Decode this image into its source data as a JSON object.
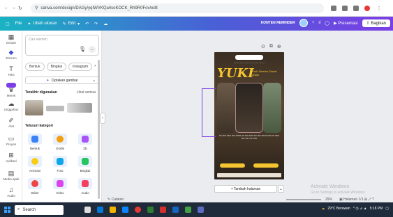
{
  "browser": {
    "url": "canva.com/design/DAGy/yqIWVKQa4soKOCK_Rh9R0Fov/edit"
  },
  "topbar": {
    "file_label": "File",
    "resize_label": "Ubah ukuran",
    "edit_label": "Edit",
    "contest_label": "KONTEN REMINDER",
    "present_label": "Presentasi",
    "share_label": "Bagikan"
  },
  "rail": {
    "items": [
      {
        "label": "Desain",
        "icon": "layout-icon"
      },
      {
        "label": "Elemen",
        "icon": "elements-icon"
      },
      {
        "label": "Teks",
        "icon": "text-icon"
      },
      {
        "label": "Merek",
        "icon": "brand-icon"
      },
      {
        "label": "Unggahan",
        "icon": "upload-icon"
      },
      {
        "label": "Alat",
        "icon": "draw-icon"
      },
      {
        "label": "Proyek",
        "icon": "projects-icon"
      },
      {
        "label": "Aplikasi",
        "icon": "apps-icon"
      },
      {
        "label": "Media ajaib",
        "icon": "magic-media-icon"
      },
      {
        "label": "Audio",
        "icon": "audio-icon"
      }
    ]
  },
  "panel": {
    "search_placeholder": "Cari elemen",
    "chips": [
      "Bentuk",
      "Bingkai",
      "Instagram"
    ],
    "generate_label": "Ciptakan gambar",
    "recent_title": "Terakhir digunakan",
    "see_all": "Lihat semua",
    "categories_title": "Telusuri kategori",
    "categories": [
      {
        "label": "Bentuk",
        "color": "#3b82f6"
      },
      {
        "label": "Grafis",
        "color": "#f59e0b"
      },
      {
        "label": "3D",
        "color": "#a855f7"
      },
      {
        "label": "Animasi",
        "color": "#facc15"
      },
      {
        "label": "Foto",
        "color": "#0ea5e9"
      },
      {
        "label": "Bingkai",
        "color": "#22c55e"
      },
      {
        "label": "Stiker",
        "color": "#ef4444"
      },
      {
        "label": "Video",
        "color": "#d946ef"
      },
      {
        "label": "Audio",
        "color": "#f43f5e"
      }
    ]
  },
  "poster": {
    "yuki": "YUKI",
    "subtitle": "Fisik Setelah Sholat Wajib"
  },
  "canvas": {
    "add_page_label": "+ Tambah halaman"
  },
  "footer": {
    "notes_label": "Catatan",
    "zoom_value": "29%",
    "pages_label": "Halaman 1/1"
  },
  "watermark": {
    "title": "Activate Windows",
    "subtitle": "Go to Settings to activate Windows."
  },
  "taskbar": {
    "search_label": "Search",
    "weather": "29°C Berawan",
    "time": "5:18 PM"
  }
}
